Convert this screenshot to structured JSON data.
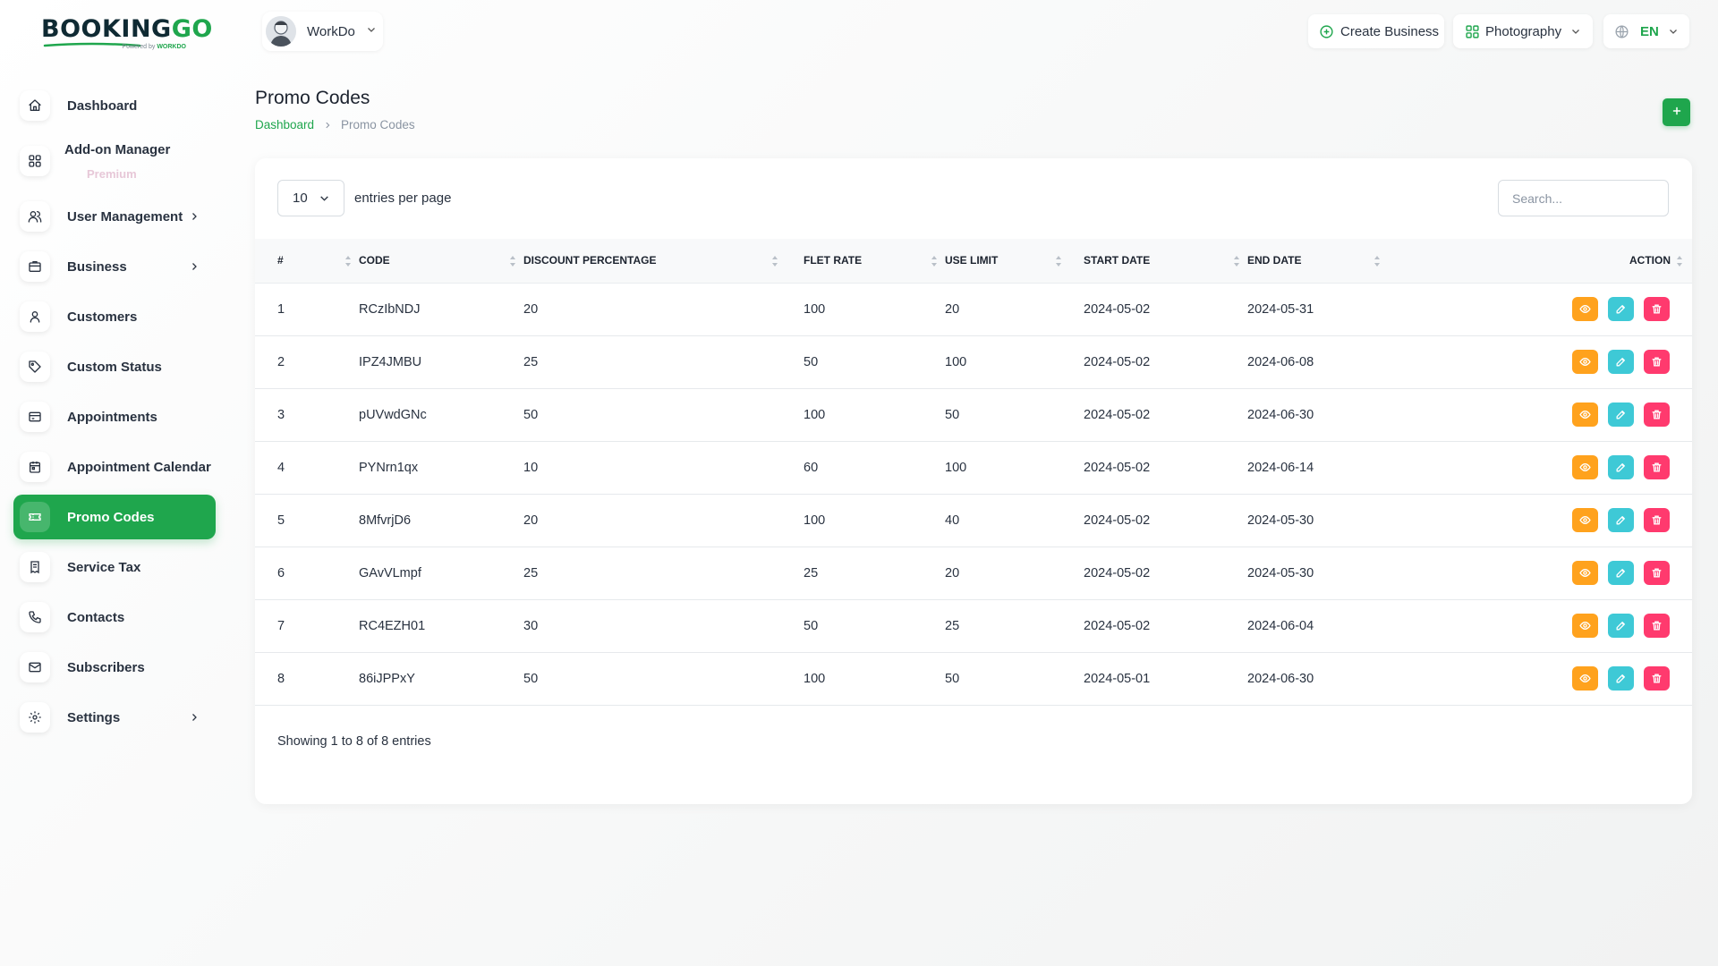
{
  "brand": {
    "logo_text_1": "BOOKING",
    "logo_text_2": "GO",
    "powered_prefix": "Powered by",
    "powered_brand": "WORKDO"
  },
  "sidebar": {
    "items": [
      {
        "label": "Dashboard",
        "icon": "home-icon",
        "active": false
      },
      {
        "label": "Add-on Manager",
        "sub": "Premium",
        "icon": "grid-icon",
        "active": false
      },
      {
        "label": "User Management",
        "icon": "users-icon",
        "active": false,
        "has_children": true
      },
      {
        "label": "Business",
        "icon": "briefcase-icon",
        "active": false,
        "has_children": true
      },
      {
        "label": "Customers",
        "icon": "user-icon",
        "active": false
      },
      {
        "label": "Custom Status",
        "icon": "tag-icon",
        "active": false
      },
      {
        "label": "Appointments",
        "icon": "card-icon",
        "active": false
      },
      {
        "label": "Appointment Calendar",
        "icon": "calendar-icon",
        "active": false
      },
      {
        "label": "Promo Codes",
        "icon": "ticket-icon",
        "active": true
      },
      {
        "label": "Service Tax",
        "icon": "receipt-icon",
        "active": false
      },
      {
        "label": "Contacts",
        "icon": "phone-icon",
        "active": false
      },
      {
        "label": "Subscribers",
        "icon": "mail-icon",
        "active": false
      },
      {
        "label": "Settings",
        "icon": "gear-icon",
        "active": false,
        "has_children": true
      }
    ]
  },
  "topbar": {
    "user_name": "WorkDo",
    "create_business": "Create Business",
    "business_select": "Photography",
    "language": "EN"
  },
  "page": {
    "title": "Promo Codes",
    "breadcrumb": [
      "Dashboard",
      "Promo Codes"
    ]
  },
  "table_controls": {
    "entries_value": "10",
    "entries_label": "entries per page",
    "search_placeholder": "Search..."
  },
  "table": {
    "columns": [
      "#",
      "CODE",
      "DISCOUNT PERCENTAGE",
      "FLET RATE",
      "USE LIMIT",
      "START DATE",
      "END DATE",
      "ACTION"
    ],
    "rows": [
      [
        "1",
        "RCzIbNDJ",
        "20",
        "100",
        "20",
        "2024-05-02",
        "2024-05-31"
      ],
      [
        "2",
        "IPZ4JMBU",
        "25",
        "50",
        "100",
        "2024-05-02",
        "2024-06-08"
      ],
      [
        "3",
        "pUVwdGNc",
        "50",
        "100",
        "50",
        "2024-05-02",
        "2024-06-30"
      ],
      [
        "4",
        "PYNrn1qx",
        "10",
        "60",
        "100",
        "2024-05-02",
        "2024-06-14"
      ],
      [
        "5",
        "8MfvrjD6",
        "20",
        "100",
        "40",
        "2024-05-02",
        "2024-05-30"
      ],
      [
        "6",
        "GAvVLmpf",
        "25",
        "25",
        "20",
        "2024-05-02",
        "2024-05-30"
      ],
      [
        "7",
        "RC4EZH01",
        "30",
        "50",
        "25",
        "2024-05-02",
        "2024-06-04"
      ],
      [
        "8",
        "86iJPPxY",
        "50",
        "100",
        "50",
        "2024-05-01",
        "2024-06-30"
      ]
    ],
    "footer": "Showing 1 to 8 of 8 entries"
  },
  "colors": {
    "primary": "#1fa64d",
    "view": "#ffa21d",
    "edit": "#3ec9d6",
    "delete": "#ff3a6e"
  }
}
